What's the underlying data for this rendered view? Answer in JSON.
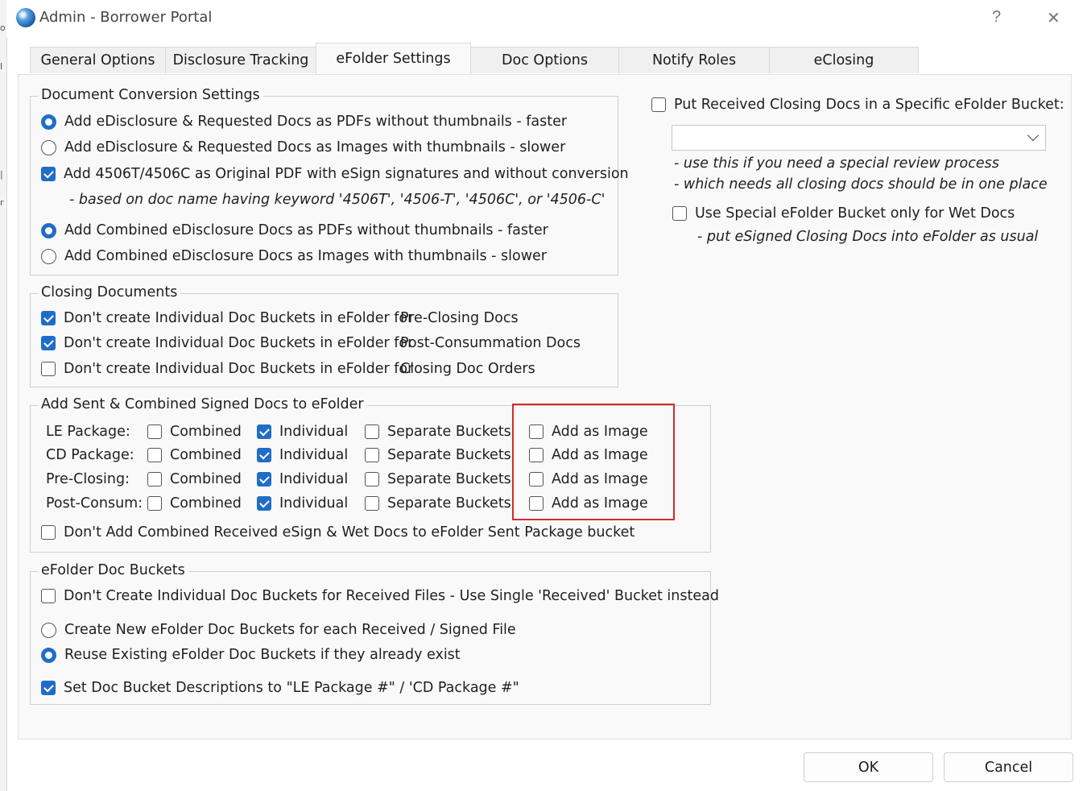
{
  "window": {
    "title": "Admin - Borrower Portal",
    "help": "?",
    "close": "✕"
  },
  "tabs": [
    "General Options",
    "Disclosure Tracking",
    "eFolder Settings",
    "Doc Options",
    "Notify Roles",
    "eClosing"
  ],
  "doc_conversion": {
    "legend": "Document Conversion Settings",
    "opt1": "Add eDisclosure & Requested Docs as PDFs without thumbnails - faster",
    "opt2": "Add eDisclosure & Requested Docs as Images with thumbnails - slower",
    "opt3": "Add 4506T/4506C as Original PDF with eSign signatures and without conversion",
    "note": "- based on doc name having keyword '4506T', '4506-T', '4506C', or '4506-C'",
    "opt4": "Add Combined eDisclosure Docs as PDFs without thumbnails - faster",
    "opt5": "Add Combined eDisclosure Docs as Images with thumbnails - slower"
  },
  "closing_docs": {
    "legend": "Closing Documents",
    "prefix": "Don't create Individual Doc Buckets in eFolder for",
    "item1": "Pre-Closing Docs",
    "item2": "Post-Consummation Docs",
    "item3": "Closing Doc Orders"
  },
  "sent_combined": {
    "legend": "Add Sent & Combined Signed Docs to eFolder",
    "rows": [
      {
        "label": "LE Package:"
      },
      {
        "label": "CD Package:"
      },
      {
        "label": "Pre-Closing:"
      },
      {
        "label": "Post-Consum:"
      }
    ],
    "combined": "Combined",
    "individual": "Individual",
    "separate": "Separate Buckets",
    "add_image": "Add as Image",
    "dont_add": "Don't Add Combined Received eSign & Wet Docs to eFolder Sent Package bucket"
  },
  "doc_buckets": {
    "legend": "eFolder Doc Buckets",
    "opt1": "Don't Create Individual Doc Buckets for Received Files - Use Single 'Received' Bucket instead",
    "opt2": "Create New eFolder Doc Buckets for each Received / Signed File",
    "opt3": "Reuse Existing eFolder Doc Buckets if they already exist",
    "opt4": "Set Doc Bucket Descriptions to \"LE Package #\" / 'CD Package #\""
  },
  "right": {
    "put_received": "Put Received Closing Docs in a Specific eFolder Bucket:",
    "select_value": "",
    "note1": "- use this if you need a special review process",
    "note2": "- which needs all closing docs should be in one place",
    "wet": "Use Special eFolder Bucket only for Wet Docs",
    "wet_note": "- put eSigned Closing Docs into eFolder as usual"
  },
  "buttons": {
    "ok": "OK",
    "cancel": "Cancel"
  },
  "colors": {
    "accent": "#1f6dc7",
    "highlight": "#d22b2b"
  }
}
